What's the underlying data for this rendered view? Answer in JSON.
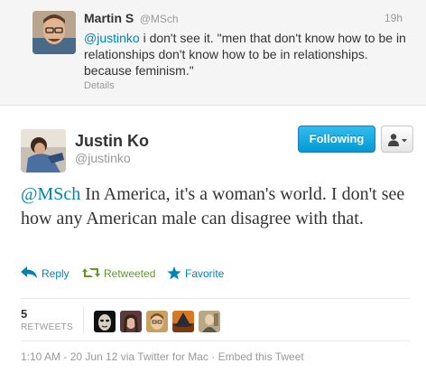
{
  "parent_tweet": {
    "name": "Martin S",
    "handle": "@MSch",
    "time": "19h",
    "mention": "@justinko",
    "text": " i don't see it. \"men that don't know how to be in relationships don't know how to be in relationships. because feminism.\"",
    "details_link": "Details"
  },
  "tweet": {
    "name": "Justin Ko",
    "handle": "@justinko",
    "follow_label": "Following",
    "mention": "@MSch",
    "text": " In America, it's a woman's world. I don't see how any American male can disagree with that.",
    "actions": {
      "reply": "Reply",
      "retweeted": "Retweeted",
      "favorite": "Favorite"
    },
    "stats": {
      "retweet_count": "5",
      "retweet_label": "RETWEETS"
    },
    "footer": {
      "timestamp": "1:10 AM - 20 Jun 12",
      "via": " via Twitter for Mac",
      "sep": " · ",
      "embed": "Embed this Tweet"
    }
  },
  "colors": {
    "link": "#0084b4",
    "retweeted_green": "#609928",
    "follow_button": "#019ad2"
  },
  "icons": {
    "reply": "reply-arrow-icon",
    "retweet": "retweet-icon",
    "favorite": "star-icon",
    "user_dropdown": "user-silhouette-icon"
  }
}
